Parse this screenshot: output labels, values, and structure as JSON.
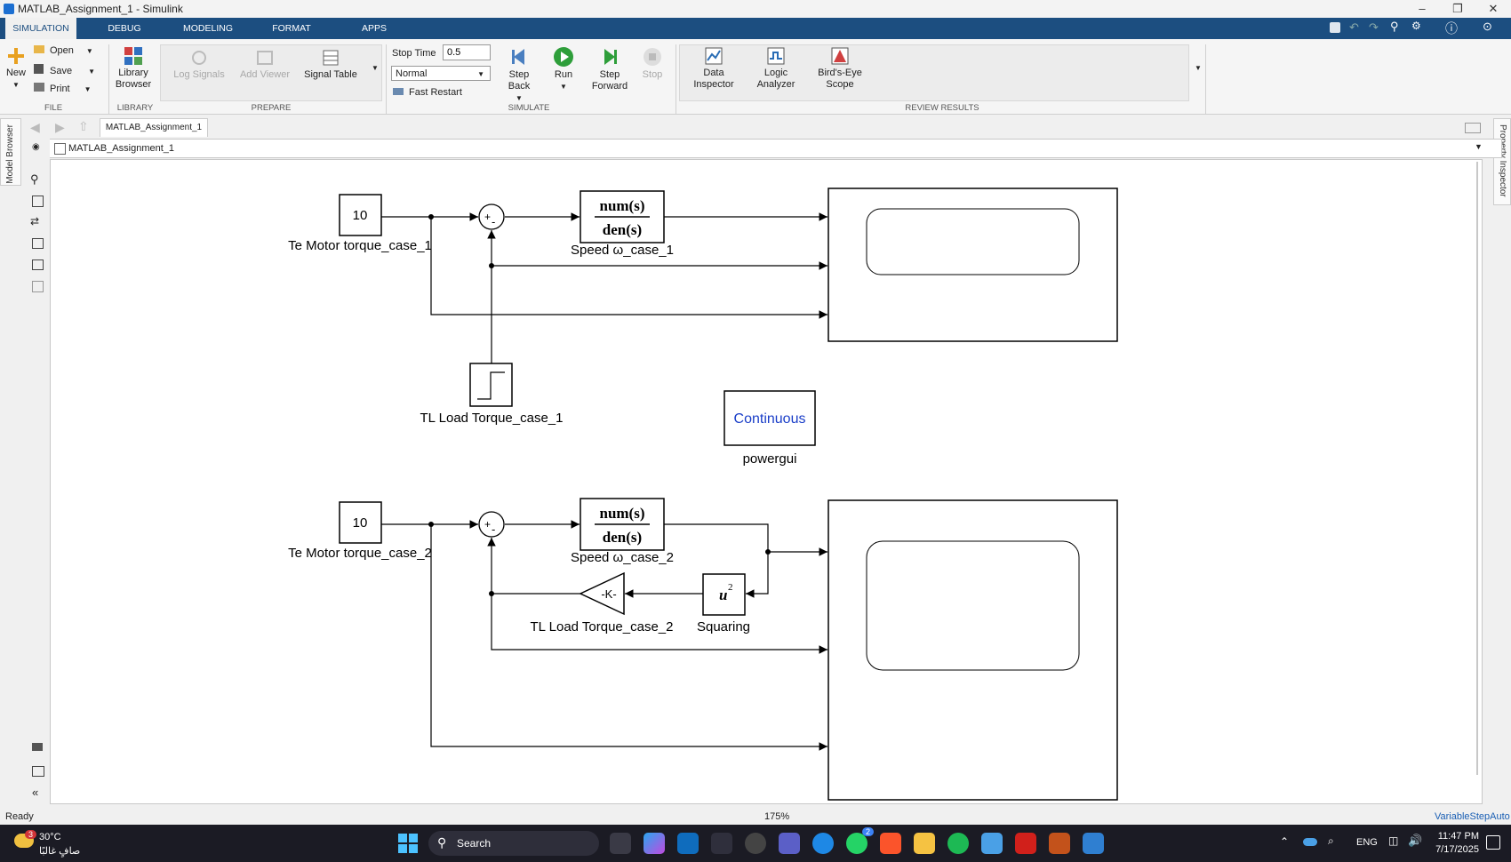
{
  "window": {
    "title": "MATLAB_Assignment_1 - Simulink"
  },
  "tabs": [
    "SIMULATION",
    "DEBUG",
    "MODELING",
    "FORMAT",
    "APPS"
  ],
  "ribbon": {
    "file": {
      "new": "New",
      "open": "Open",
      "save": "Save",
      "print": "Print",
      "label": "FILE"
    },
    "library": {
      "browser": "Library Browser",
      "label": "LIBRARY"
    },
    "prepare": {
      "log_signals": "Log Signals",
      "add_viewer": "Add Viewer",
      "signal_table": "Signal Table",
      "label": "PREPARE"
    },
    "simulate": {
      "stop_time_label": "Stop Time",
      "stop_time_value": "0.5",
      "mode": "Normal",
      "fast_restart": "Fast Restart",
      "step_back": "Step Back",
      "run": "Run",
      "step_forward": "Step Forward",
      "stop": "Stop",
      "label": "SIMULATE"
    },
    "review": {
      "data_inspector": "Data Inspector",
      "logic_analyzer": "Logic Analyzer",
      "birds_eye": "Bird's-Eye Scope",
      "label": "REVIEW RESULTS"
    }
  },
  "nav": {
    "tab": "MATLAB_Assignment_1",
    "breadcrumb": "MATLAB_Assignment_1"
  },
  "side": {
    "model_browser": "Model Browser",
    "property_inspector": "Property Inspector"
  },
  "diagram": {
    "const1_value": "10",
    "const1_label": "Te Motor torque_case_1",
    "tf_num": "num(s)",
    "tf_den": "den(s)",
    "tf1_label": "Speed ω_case_1",
    "step_label": "TL Load Torque_case_1",
    "powergui_text": "Continuous",
    "powergui_label": "powergui",
    "const2_value": "10",
    "const2_label": "Te Motor torque_case_2",
    "tf2_label": "Speed ω_case_2",
    "gain_text": "-K-",
    "gain_label": "TL Load Torque_case_2",
    "square_label": "Squaring",
    "sum_plus": "+",
    "sum_minus": "-"
  },
  "status": {
    "left": "Ready",
    "zoom": "175%",
    "solver": "VariableStepAuto"
  },
  "taskbar": {
    "temp": "30°C",
    "weather": "صافٍ غالبًا",
    "badge": "3",
    "search": "Search",
    "lang": "ENG",
    "time": "11:47 PM",
    "date": "7/17/2025",
    "teams_badge": "2"
  }
}
